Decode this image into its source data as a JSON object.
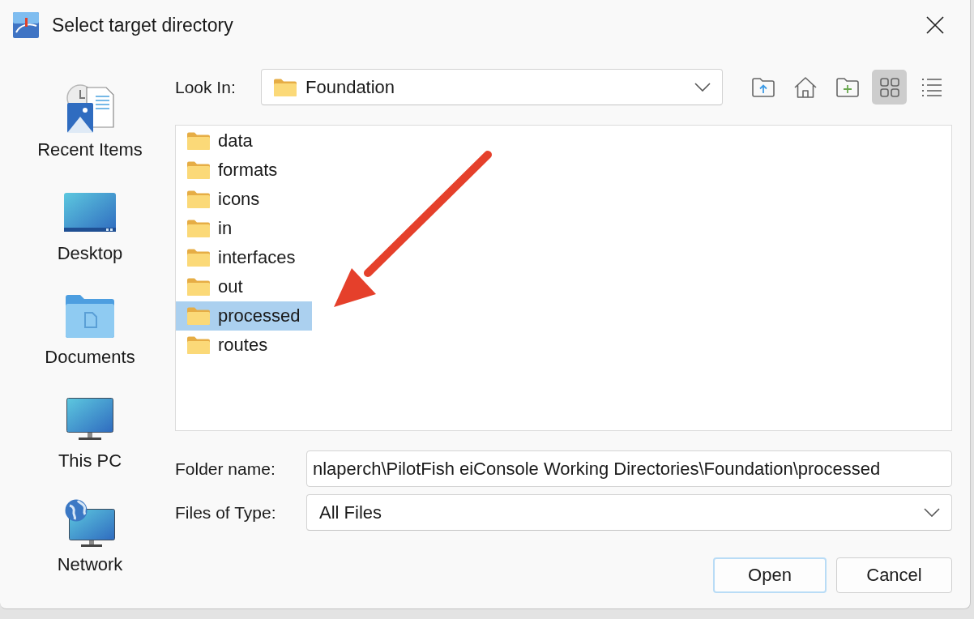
{
  "window": {
    "title": "Select target directory"
  },
  "sidebar": {
    "items": [
      {
        "label": "Recent Items",
        "kind": "recent"
      },
      {
        "label": "Desktop",
        "kind": "desktop"
      },
      {
        "label": "Documents",
        "kind": "documents"
      },
      {
        "label": "This PC",
        "kind": "computer"
      },
      {
        "label": "Network",
        "kind": "network"
      }
    ]
  },
  "look_in": {
    "label": "Look In:",
    "value": "Foundation"
  },
  "toolbar": {
    "actions": [
      {
        "kind": "up"
      },
      {
        "kind": "home"
      },
      {
        "kind": "new_folder"
      }
    ],
    "views": [
      {
        "kind": "grid",
        "selected": true
      },
      {
        "kind": "list",
        "selected": false
      }
    ]
  },
  "file_list": {
    "items": [
      {
        "name": "data",
        "selected": false
      },
      {
        "name": "formats",
        "selected": false
      },
      {
        "name": "icons",
        "selected": false
      },
      {
        "name": "in",
        "selected": false
      },
      {
        "name": "interfaces",
        "selected": false
      },
      {
        "name": "out",
        "selected": false
      },
      {
        "name": "processed",
        "selected": true
      },
      {
        "name": "routes",
        "selected": false
      }
    ]
  },
  "folder_name": {
    "label": "Folder name:",
    "value": "nlaperch\\PilotFish eiConsole Working Directories\\Foundation\\processed"
  },
  "files_of_type": {
    "label": "Files of Type:",
    "value": "All Files"
  },
  "buttons": [
    {
      "label": "Open",
      "focused": true
    },
    {
      "label": "Cancel",
      "focused": false
    }
  ]
}
